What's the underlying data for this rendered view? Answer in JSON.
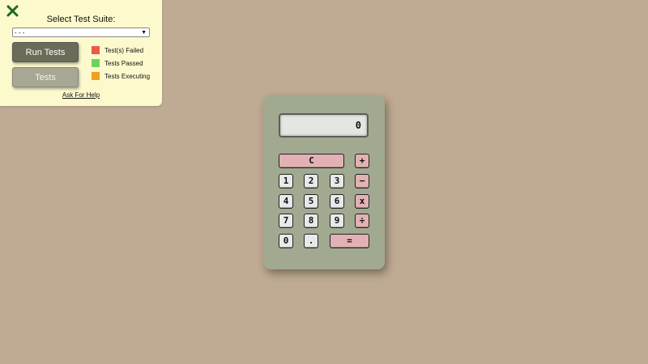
{
  "panel": {
    "title": "Select Test Suite:",
    "select_value": "- - -",
    "run_button": "Run Tests",
    "tests_button": "Tests",
    "legend": [
      {
        "label": "Test(s) Failed",
        "color": "#e95b45"
      },
      {
        "label": "Tests Passed",
        "color": "#6ed25f"
      },
      {
        "label": "Tests Executing",
        "color": "#f0a020"
      }
    ],
    "help_link": "Ask For Help",
    "close_icon_color": "#1a6b1a"
  },
  "calculator": {
    "display": "0",
    "keys": {
      "clear": "C",
      "plus": "+",
      "minus": "−",
      "times": "x",
      "divide": "÷",
      "equals": "=",
      "decimal": ".",
      "n0": "0",
      "n1": "1",
      "n2": "2",
      "n3": "3",
      "n4": "4",
      "n5": "5",
      "n6": "6",
      "n7": "7",
      "n8": "8",
      "n9": "9"
    }
  }
}
